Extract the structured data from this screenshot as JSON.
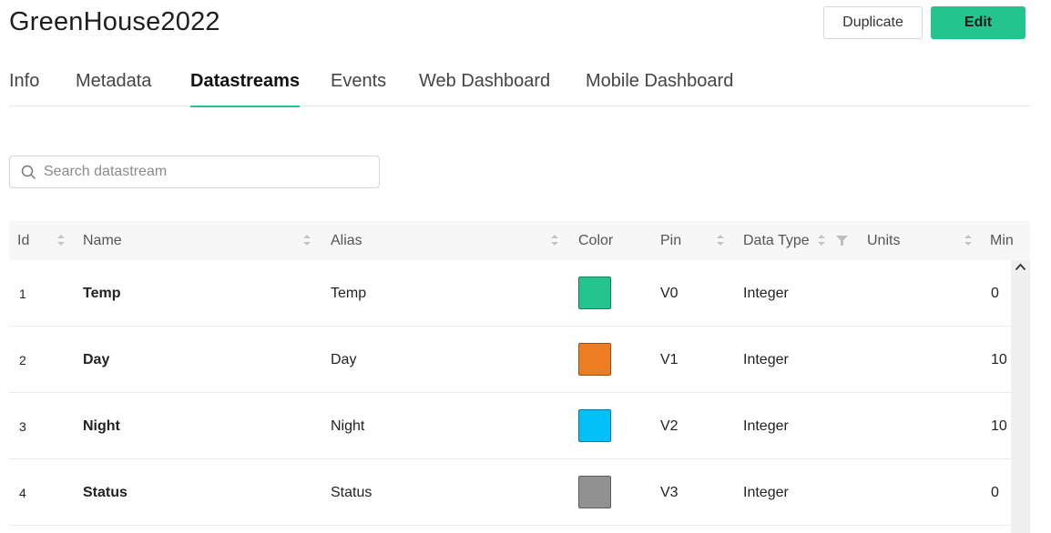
{
  "header": {
    "title": "GreenHouse2022",
    "duplicate_label": "Duplicate",
    "edit_label": "Edit"
  },
  "tabs": [
    {
      "label": "Info"
    },
    {
      "label": "Metadata"
    },
    {
      "label": "Datastreams",
      "active": true
    },
    {
      "label": "Events"
    },
    {
      "label": "Web Dashboard"
    },
    {
      "label": "Mobile Dashboard"
    }
  ],
  "search": {
    "placeholder": "Search datastream",
    "value": ""
  },
  "table": {
    "columns": [
      "Id",
      "Name",
      "Alias",
      "Color",
      "Pin",
      "Data Type",
      "Units",
      "Min"
    ],
    "rows": [
      {
        "id": "1",
        "name": "Temp",
        "alias": "Temp",
        "color": "#23c48e",
        "pin": "V0",
        "data_type": "Integer",
        "units": "",
        "min": "0"
      },
      {
        "id": "2",
        "name": "Day",
        "alias": "Day",
        "color": "#ed7d22",
        "pin": "V1",
        "data_type": "Integer",
        "units": "",
        "min": "10"
      },
      {
        "id": "3",
        "name": "Night",
        "alias": "Night",
        "color": "#04c0f8",
        "pin": "V2",
        "data_type": "Integer",
        "units": "",
        "min": "10"
      },
      {
        "id": "4",
        "name": "Status",
        "alias": "Status",
        "color": "#919191",
        "pin": "V3",
        "data_type": "Integer",
        "units": "",
        "min": "0"
      }
    ]
  },
  "colors": {
    "accent": "#23c48e"
  },
  "icons": {
    "search": "search-icon",
    "sort": "sort-icon",
    "filter": "filter-icon",
    "scroll_up": "chevron-up-icon"
  }
}
